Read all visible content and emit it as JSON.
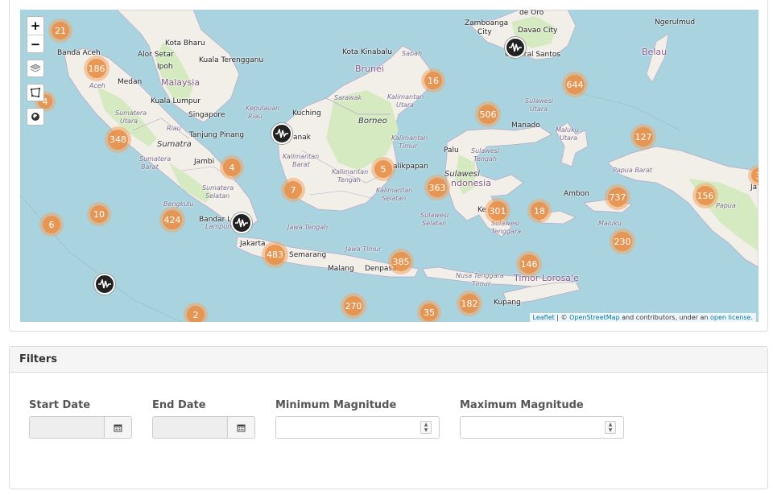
{
  "map": {
    "zoom_in": "+",
    "zoom_out": "−",
    "attribution": {
      "leaflet": "Leaflet",
      "separator": " | © ",
      "osm": "OpenStreetMap",
      "middle": " and contributors, under an ",
      "license": "open license",
      "end": "."
    },
    "labels": [
      {
        "text": "Zamboanga",
        "kind": "city"
      },
      {
        "text": "City",
        "kind": "city"
      },
      {
        "text": "de Oro",
        "kind": "city"
      },
      {
        "text": "Davao City",
        "kind": "city"
      },
      {
        "text": "General Santos",
        "kind": "city"
      },
      {
        "text": "Ngerulmud",
        "kind": "city"
      },
      {
        "text": "Belau",
        "kind": "country"
      },
      {
        "text": "Kota Bharu",
        "kind": "city"
      },
      {
        "text": "Alor Setar",
        "kind": "city"
      },
      {
        "text": "Kuala Terengganu",
        "kind": "city"
      },
      {
        "text": "Banda Aceh",
        "kind": "city"
      },
      {
        "text": "Ipoh",
        "kind": "city"
      },
      {
        "text": "Malaysia",
        "kind": "country"
      },
      {
        "text": "Medan",
        "kind": "city"
      },
      {
        "text": "Aceh",
        "kind": "region"
      },
      {
        "text": "Kuala Lumpur",
        "kind": "city"
      },
      {
        "text": "Kota Kinabalu",
        "kind": "city"
      },
      {
        "text": "Sabah",
        "kind": "region"
      },
      {
        "text": "Brunei",
        "kind": "country"
      },
      {
        "text": "Sarawak",
        "kind": "region"
      },
      {
        "text": "Kalimantan",
        "kind": "region"
      },
      {
        "text": "Utara",
        "kind": "region"
      },
      {
        "text": "Kepulauan",
        "kind": "region"
      },
      {
        "text": "Riau",
        "kind": "region"
      },
      {
        "text": "Singapore",
        "kind": "city"
      },
      {
        "text": "Kuching",
        "kind": "city"
      },
      {
        "text": "Borneo",
        "kind": "island"
      },
      {
        "text": "Sumatera",
        "kind": "region"
      },
      {
        "text": "Utara",
        "kind": "region"
      },
      {
        "text": "Riau",
        "kind": "region"
      },
      {
        "text": "Tanjung Pinang",
        "kind": "city"
      },
      {
        "text": "Sumatra",
        "kind": "island"
      },
      {
        "text": "Sumatera",
        "kind": "region"
      },
      {
        "text": "Barat",
        "kind": "region"
      },
      {
        "text": "Jambi",
        "kind": "city"
      },
      {
        "text": "Kalimantan",
        "kind": "region"
      },
      {
        "text": "Barat",
        "kind": "region"
      },
      {
        "text": "anak",
        "kind": "city"
      },
      {
        "text": "Kalimantan",
        "kind": "region"
      },
      {
        "text": "Timur",
        "kind": "region"
      },
      {
        "text": "Kalimantan",
        "kind": "region"
      },
      {
        "text": "Tengah",
        "kind": "region"
      },
      {
        "text": "alikpapan",
        "kind": "city"
      },
      {
        "text": "Kalimantan",
        "kind": "region"
      },
      {
        "text": "Selatan",
        "kind": "region"
      },
      {
        "text": "Sumatera",
        "kind": "region"
      },
      {
        "text": "Selatan",
        "kind": "region"
      },
      {
        "text": "Bengkulu",
        "kind": "region"
      },
      {
        "text": "Lampung",
        "kind": "region"
      },
      {
        "text": "Bandar La",
        "kind": "city"
      },
      {
        "text": "Jakarta",
        "kind": "city"
      },
      {
        "text": "Jawa Tengah",
        "kind": "region"
      },
      {
        "text": "Semarang",
        "kind": "city"
      },
      {
        "text": "Jawa Timur",
        "kind": "region"
      },
      {
        "text": "Malang",
        "kind": "city"
      },
      {
        "text": "Denpasa",
        "kind": "city"
      },
      {
        "text": "Palu",
        "kind": "city"
      },
      {
        "text": "Sulawesi",
        "kind": "region"
      },
      {
        "text": "Tengah",
        "kind": "region"
      },
      {
        "text": "Sulawesi",
        "kind": "island"
      },
      {
        "text": "ndonesia",
        "kind": "country"
      },
      {
        "text": "Sulawesi",
        "kind": "region"
      },
      {
        "text": "Utara",
        "kind": "region"
      },
      {
        "text": "Manado",
        "kind": "city"
      },
      {
        "text": "Maluku",
        "kind": "region"
      },
      {
        "text": "Utara",
        "kind": "region"
      },
      {
        "text": "Sulawesi",
        "kind": "region"
      },
      {
        "text": "Selatan",
        "kind": "region"
      },
      {
        "text": "Ke",
        "kind": "city"
      },
      {
        "text": "Sulawesi",
        "kind": "region"
      },
      {
        "text": "Tenggara",
        "kind": "region"
      },
      {
        "text": "Ambon",
        "kind": "city"
      },
      {
        "text": "Maluku",
        "kind": "region"
      },
      {
        "text": "Papua Barat",
        "kind": "region"
      },
      {
        "text": "Papua",
        "kind": "region"
      },
      {
        "text": "Ja",
        "kind": "city"
      },
      {
        "text": "Nusa Tenggara",
        "kind": "region"
      },
      {
        "text": "Timur",
        "kind": "region"
      },
      {
        "text": "Timor Lorosa'e",
        "kind": "country"
      },
      {
        "text": "Kupang",
        "kind": "city"
      }
    ],
    "clusters": [
      "21",
      "186",
      "4",
      "348",
      "4",
      "7",
      "5",
      "16",
      "506",
      "644",
      "127",
      "363",
      "301",
      "18",
      "737",
      "156",
      "3",
      "6",
      "10",
      "424",
      "483",
      "385",
      "146",
      "230",
      "2",
      "270",
      "35",
      "182"
    ],
    "quake_markers": [
      "earthquake-marker-general-santos",
      "earthquake-marker-pontianak",
      "earthquake-marker-lampung",
      "earthquake-marker-indian-ocean"
    ]
  },
  "filters": {
    "title": "Filters",
    "start_date_label": "Start Date",
    "end_date_label": "End Date",
    "min_magnitude_label": "Minimum Magnitude",
    "max_magnitude_label": "Maximum Magnitude"
  },
  "colors": {
    "sea": "#a9d3de",
    "land": "#f2efe9",
    "forest": "#cfe6b8",
    "cluster_outer": "#f1a86b",
    "cluster_inner": "#e98e47"
  }
}
